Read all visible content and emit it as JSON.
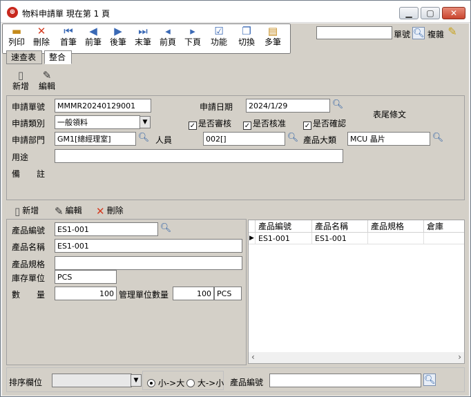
{
  "window": {
    "title": "物料申請單  現在第 1 頁",
    "icon_name": "app-logo-icon",
    "minimize_label": "▁",
    "maximize_label": "▢",
    "close_label": "✕"
  },
  "toolbar": {
    "items": [
      {
        "label": "列印",
        "icon": "print-icon"
      },
      {
        "label": "刪除",
        "icon": "delete-icon"
      },
      {
        "label": "首筆",
        "icon": "first-record-icon"
      },
      {
        "label": "前筆",
        "icon": "prev-record-icon"
      },
      {
        "label": "後筆",
        "icon": "next-record-icon"
      },
      {
        "label": "末筆",
        "icon": "last-record-icon"
      },
      {
        "label": "前頁",
        "icon": "prev-page-icon"
      },
      {
        "label": "下頁",
        "icon": "next-page-icon"
      },
      {
        "label": "功能",
        "icon": "function-icon"
      },
      {
        "label": "切換",
        "icon": "switch-icon"
      },
      {
        "label": "多筆",
        "icon": "multi-record-icon"
      }
    ],
    "search_value": "",
    "doc_no_label": "單號",
    "copy_label": "複雜"
  },
  "tabs": [
    {
      "label": "速查表"
    },
    {
      "label": "整合"
    }
  ],
  "header_actions": {
    "new_label": "新增",
    "edit_label": "編輯"
  },
  "form": {
    "req_no_label": "申請單號",
    "req_no_value": "MMMR20240129001",
    "req_date_label": "申請日期",
    "req_date_value": "2024/1/29",
    "footer_text_label": "表尾條文",
    "req_type_label": "申請類別",
    "req_type_value": "一般領料",
    "check_review": "是否審核",
    "check_approve": "是否核准",
    "check_confirm": "是否確認",
    "req_dept_label": "申請部門",
    "req_dept_value": "GM1[總經理室]",
    "person_label": "人員",
    "person_value": "002[]",
    "product_cat_label": "產品大類",
    "product_cat_value": "MCU 晶片",
    "purpose_label": "用途",
    "purpose_value": "",
    "remark_label": "備　　註",
    "remark_value": ""
  },
  "detail_actions": {
    "new_label": "新增",
    "edit_label": "編輯",
    "delete_label": "刪除"
  },
  "detail": {
    "product_no_label": "產品編號",
    "product_no_value": "ES1-001",
    "product_name_label": "產品名稱",
    "product_name_value": "ES1-001",
    "product_spec_label": "產品規格",
    "product_spec_value": "",
    "stock_unit_label": "庫存單位",
    "stock_unit_value": "PCS",
    "qty_label": "數　　量",
    "qty_value": "100",
    "mgmt_qty_label": "管理單位數量",
    "mgmt_qty_value": "100",
    "mgmt_unit_value": "PCS"
  },
  "grid": {
    "columns": [
      "產品編號",
      "產品名稱",
      "產品規格",
      "倉庫"
    ],
    "rows": [
      [
        "ES1-001",
        "ES1-001",
        "",
        ""
      ]
    ]
  },
  "footer": {
    "sort_label": "排序欄位",
    "sort_value": "",
    "asc_label": "小->大",
    "desc_label": "大->小",
    "product_no_label": "產品編號",
    "product_no_value": ""
  }
}
